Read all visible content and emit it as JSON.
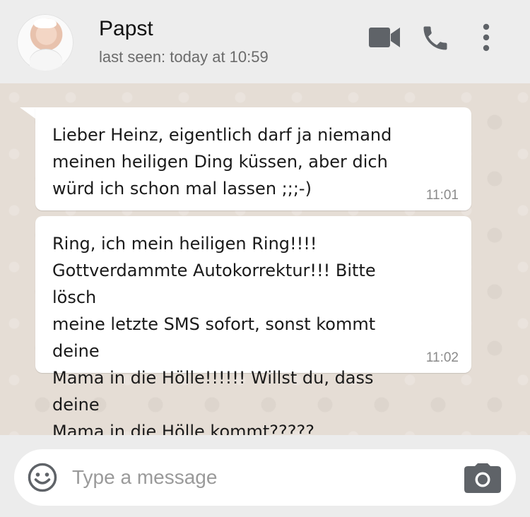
{
  "header": {
    "contact_name": "Papst",
    "last_seen": "last seen: today at 10:59",
    "icons": [
      "video-call-icon",
      "phone-icon",
      "more-options-icon"
    ]
  },
  "messages": [
    {
      "direction": "incoming",
      "text": "Lieber Heinz, eigentlich darf ja niemand\nmeinen heiligen Ding küssen, aber dich\nwürd ich schon mal lassen ;;;-)",
      "time": "11:01"
    },
    {
      "direction": "incoming",
      "text": "Ring, ich mein heiligen Ring!!!!\nGottverdammte Autokorrektur!!! Bitte lösch\nmeine letzte SMS sofort, sonst kommt deine\nMama in die Hölle!!!!!! Willst du, dass deine\nMama in die Hölle kommt?????",
      "time": "11:02"
    }
  ],
  "composer": {
    "placeholder": "Type a message",
    "icons": [
      "emoji-icon",
      "camera-icon"
    ]
  },
  "colors": {
    "header_bg": "#ededed",
    "chat_bg": "#e5ddd5",
    "bubble_bg": "#ffffff",
    "icon_gray": "#5f6368"
  }
}
